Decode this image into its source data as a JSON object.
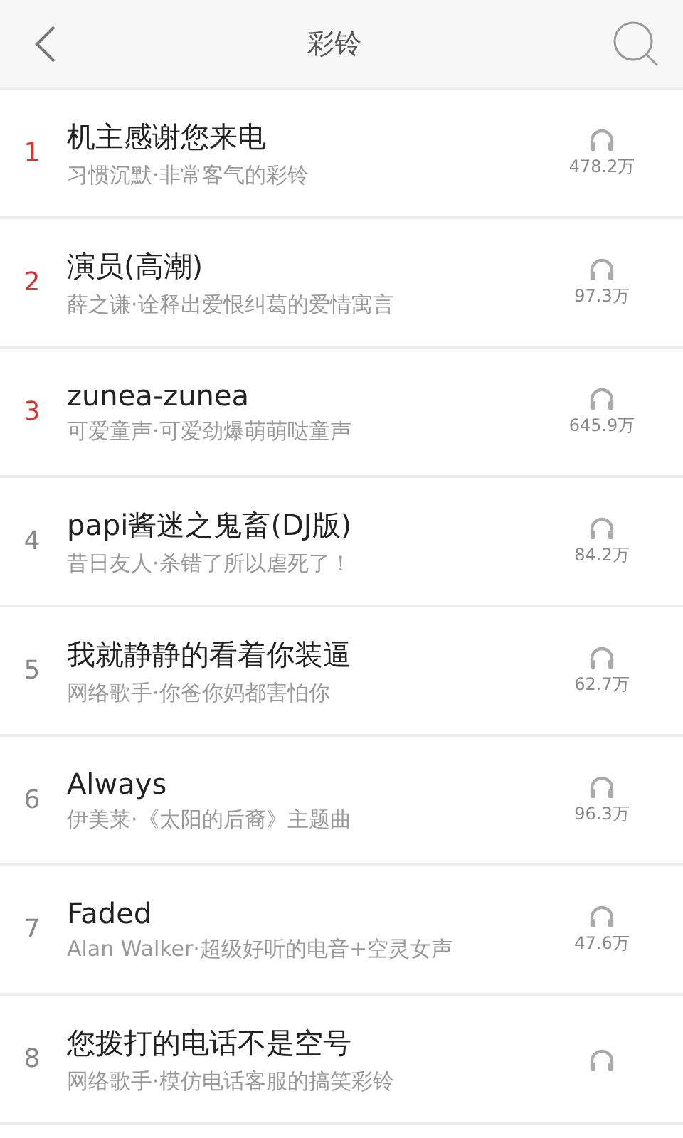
{
  "header": {
    "title": "彩铃"
  },
  "songs": [
    {
      "rank": "1",
      "highlight": true,
      "title": "机主感谢您来电",
      "subtitle": "习惯沉默·非常客气的彩铃",
      "plays": "478.2万"
    },
    {
      "rank": "2",
      "highlight": true,
      "title": "演员(高潮)",
      "subtitle": "薛之谦·诠释出爱恨纠葛的爱情寓言",
      "plays": "97.3万"
    },
    {
      "rank": "3",
      "highlight": true,
      "title": "zunea-zunea",
      "subtitle": "可爱童声·可爱劲爆萌萌哒童声",
      "plays": "645.9万"
    },
    {
      "rank": "4",
      "highlight": false,
      "title": "papi酱迷之鬼畜(DJ版)",
      "subtitle": "昔日友人·杀错了所以虐死了！",
      "plays": "84.2万"
    },
    {
      "rank": "5",
      "highlight": false,
      "title": "我就静静的看着你装逼",
      "subtitle": "网络歌手·你爸你妈都害怕你",
      "plays": "62.7万"
    },
    {
      "rank": "6",
      "highlight": false,
      "title": "Always",
      "subtitle": "伊美莱·《太阳的后裔》主题曲",
      "plays": "96.3万"
    },
    {
      "rank": "7",
      "highlight": false,
      "title": "Faded",
      "subtitle": "Alan Walker·超级好听的电音+空灵女声",
      "plays": "47.6万"
    },
    {
      "rank": "8",
      "highlight": false,
      "title": "您拨打的电话不是空号",
      "subtitle": "网络歌手·模仿电话客服的搞笑彩铃"
    }
  ]
}
